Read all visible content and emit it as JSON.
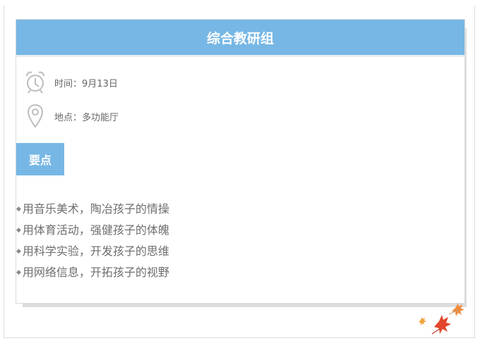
{
  "card": {
    "title": "综合教研组",
    "time": {
      "label": "时间",
      "value": "9月13日",
      "icon": "alarm-clock-icon"
    },
    "location": {
      "label": "地点",
      "value": "多功能厅",
      "icon": "location-pin-icon"
    },
    "section_label": "要点",
    "points": [
      "用音乐美术，陶冶孩子的情操",
      "用体育活动，强健孩子的体魄",
      "用科学实验，开发孩子的思维",
      "用网络信息，开拓孩子的视野"
    ]
  },
  "decoration": {
    "icon": "maple-leaves-icon"
  },
  "colors": {
    "accent": "#76b7e5",
    "text": "#6e6e6e",
    "leaf_red": "#e2452b",
    "leaf_orange": "#f08a3c"
  }
}
